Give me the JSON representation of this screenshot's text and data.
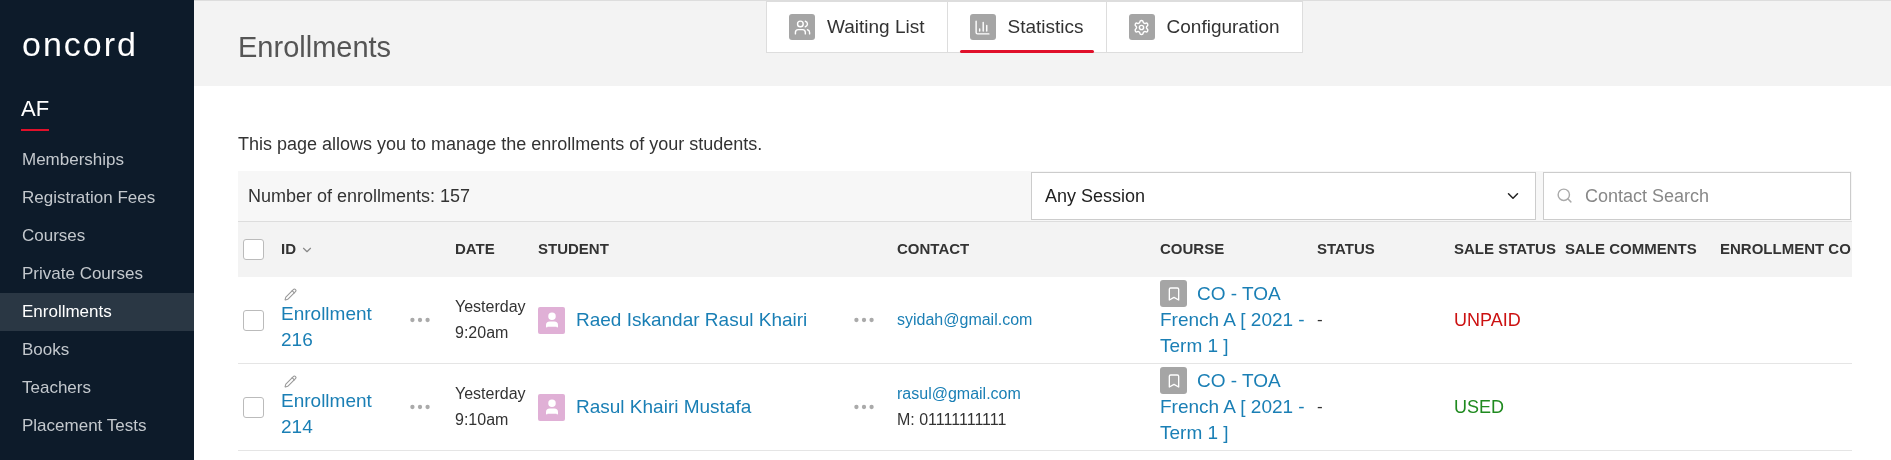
{
  "sidebar": {
    "logo": "oncord",
    "section": "AF",
    "items": [
      {
        "label": "Memberships",
        "selected": false
      },
      {
        "label": "Registration Fees",
        "selected": false
      },
      {
        "label": "Courses",
        "selected": false
      },
      {
        "label": "Private Courses",
        "selected": false
      },
      {
        "label": "Enrollments",
        "selected": true
      },
      {
        "label": "Books",
        "selected": false
      },
      {
        "label": "Teachers",
        "selected": false
      },
      {
        "label": "Placement Tests",
        "selected": false
      }
    ]
  },
  "header": {
    "title": "Enrollments",
    "tabs": [
      {
        "label": "Waiting List",
        "selected": false
      },
      {
        "label": "Statistics",
        "selected": true
      },
      {
        "label": "Configuration",
        "selected": false
      }
    ]
  },
  "description": "This page allows you to manage the enrollments of your students.",
  "toolbar": {
    "count": "Number of enrollments: 157",
    "session_select": "Any Session",
    "search": {
      "placeholder": "Contact Search"
    }
  },
  "table": {
    "select_all_checked": false,
    "columns": [
      "ID",
      "DATE",
      "STUDENT",
      "CONTACT",
      "COURSE",
      "STATUS",
      "SALE STATUS",
      "SALE COMMENTS",
      "ENROLLMENT CO"
    ],
    "rows": [
      {
        "checked": false,
        "id": "Enrollment 216",
        "date": "Yesterday",
        "time": "9:20am",
        "student": "Raed Iskandar Rasul Khairi",
        "email": "syidah@gmail.com",
        "course": "CO - TOA French A [ 2021 - Term 1 ]",
        "status": "-",
        "sale_status": {
          "text": "UNPAID",
          "color": "#cc1111"
        }
      },
      {
        "checked": false,
        "id": "Enrollment 214",
        "date": "Yesterday",
        "time": "9:10am",
        "student": "Rasul Khairi Mustafa",
        "email": "rasul@gmail.com",
        "phone": "M: 01111111111",
        "course": "CO - TOA French A [ 2021 - Term 1 ]",
        "status": "-",
        "sale_status": {
          "text": "USED",
          "color": "#1f8a1f"
        }
      }
    ]
  }
}
